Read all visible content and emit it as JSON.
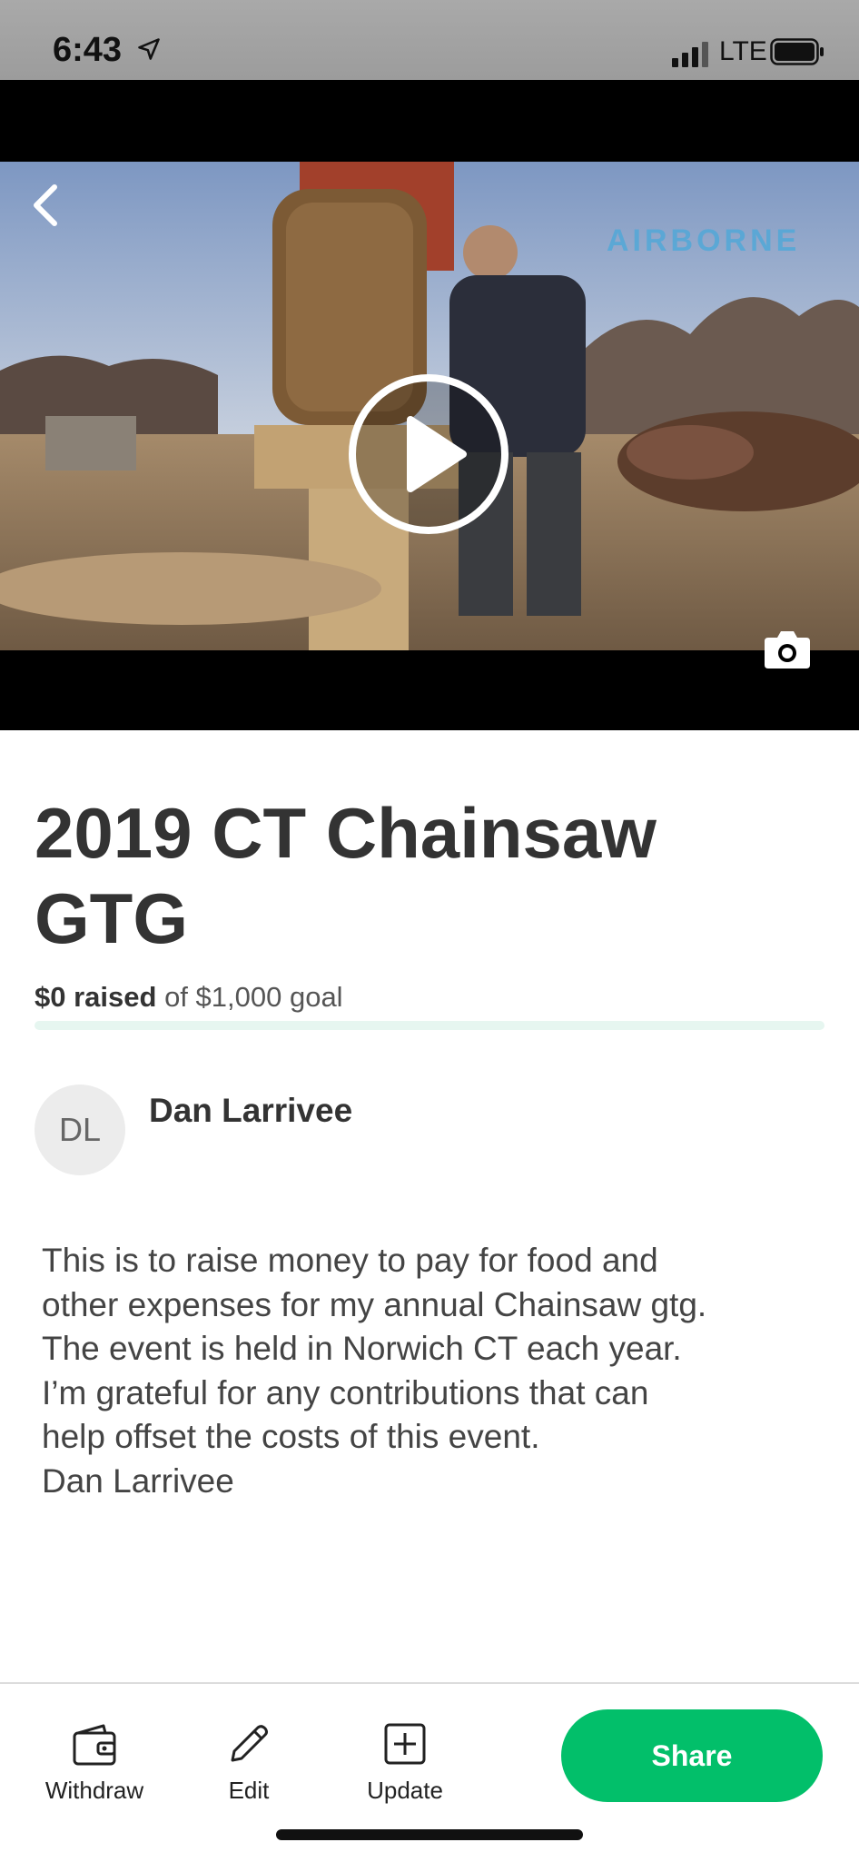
{
  "status_bar": {
    "time": "6:43",
    "network": "LTE"
  },
  "media": {
    "watermark": "AIRBORNE",
    "icons": {
      "back": "chevron-left-icon",
      "play": "play-icon",
      "camera": "camera-icon"
    }
  },
  "campaign": {
    "title": "2019 CT Chainsaw GTG",
    "raised_amount": "$0 raised",
    "goal_text": "of $1,000 goal",
    "progress_fraction": 0
  },
  "organizer": {
    "initials": "DL",
    "name": "Dan Larrivee"
  },
  "description": "This is to raise money to pay for food and\nother expenses for my annual Chainsaw gtg.\nThe event is held in Norwich CT each year.\nI’m grateful for any contributions that can\nhelp offset the costs of this event.\nDan Larrivee",
  "toolbar": {
    "withdraw_label": "Withdraw",
    "edit_label": "Edit",
    "update_label": "Update",
    "share_label": "Share"
  },
  "colors": {
    "accent": "#02bf6a",
    "progress_track": "#e6f6f0"
  }
}
